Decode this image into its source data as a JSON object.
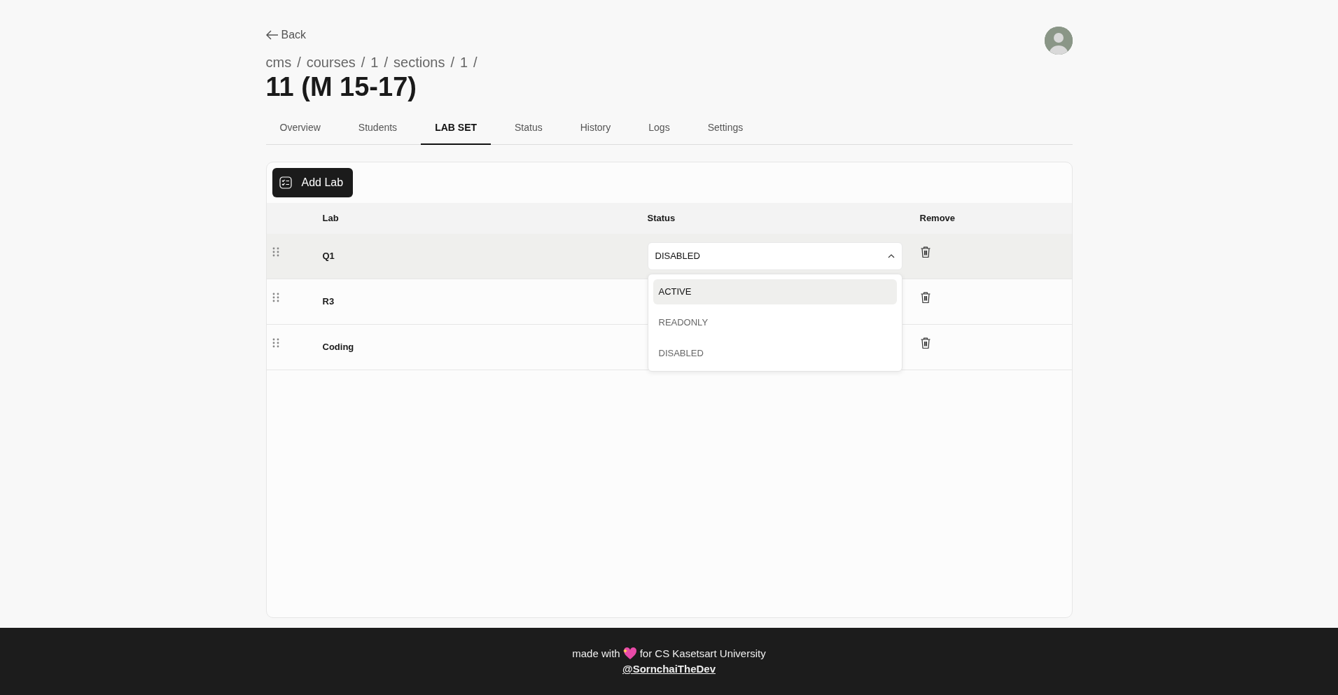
{
  "back": {
    "label": "Back"
  },
  "breadcrumb": [
    {
      "label": "cms",
      "separator": "/"
    },
    {
      "label": "courses",
      "separator": "/"
    },
    {
      "label": "1",
      "separator": "/"
    },
    {
      "label": "sections",
      "separator": "/"
    },
    {
      "label": "1",
      "separator": "/"
    }
  ],
  "title": "11 (M 15-17)",
  "tabs": [
    {
      "label": "Overview",
      "selected": false
    },
    {
      "label": "Students",
      "selected": false
    },
    {
      "label": "LAB SET",
      "selected": true
    },
    {
      "label": "Status",
      "selected": false
    },
    {
      "label": "History",
      "selected": false
    },
    {
      "label": "Logs",
      "selected": false
    },
    {
      "label": "Settings",
      "selected": false
    }
  ],
  "add_button": {
    "label": "Add Lab"
  },
  "table": {
    "columns": [
      "Lab",
      "Status",
      "Remove"
    ],
    "rows": [
      {
        "name": "Q1",
        "status": "DISABLED",
        "expanded": true,
        "highlighted": true
      },
      {
        "name": "R3",
        "highlighted": false
      },
      {
        "name": "Coding",
        "highlighted": false
      }
    ]
  },
  "status_menu": {
    "options": [
      {
        "label": "ACTIVE",
        "highlighted": true
      },
      {
        "label": "READONLY",
        "highlighted": false
      },
      {
        "label": "DISABLED",
        "highlighted": false
      }
    ]
  },
  "footer": {
    "before": "made with",
    "after": "for CS Kasetsart University",
    "link": "@SornchaiTheDev"
  }
}
